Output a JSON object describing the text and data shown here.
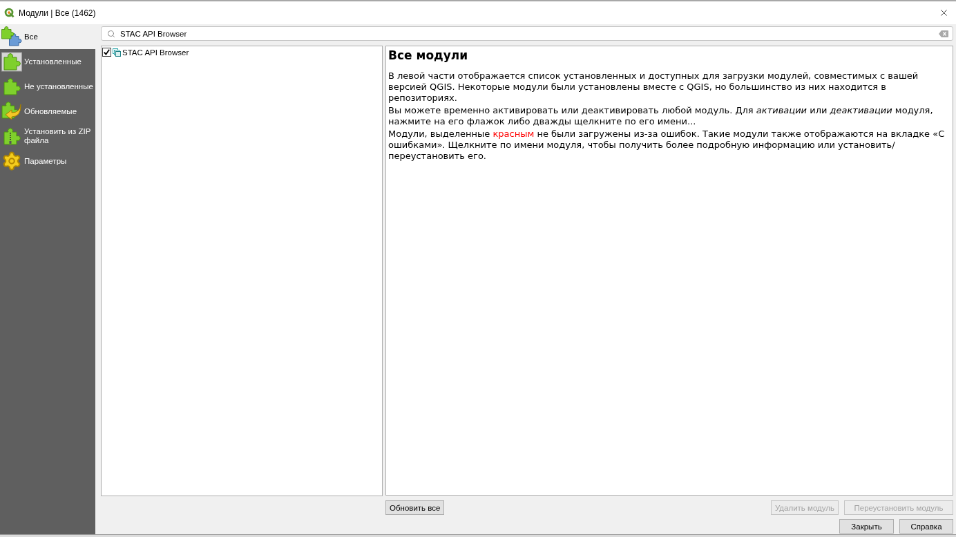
{
  "window": {
    "title": "Модули | Все (1462)"
  },
  "sidebar": {
    "items": [
      {
        "label": "Все",
        "kind": "all",
        "selected": true
      },
      {
        "label": "Установленные",
        "kind": "installed",
        "selected": false
      },
      {
        "label": "Не установленные",
        "kind": "not_installed",
        "selected": false
      },
      {
        "label": "Обновляемые",
        "kind": "upgradeable",
        "selected": false
      },
      {
        "label": "Установить из ZIP файла",
        "kind": "zip",
        "selected": false
      },
      {
        "label": "Параметры",
        "kind": "settings",
        "selected": false
      }
    ]
  },
  "search": {
    "value": "STAC API Browser"
  },
  "plugin_list": {
    "items": [
      {
        "name": "STAC API Browser",
        "checked": true
      }
    ]
  },
  "info": {
    "title": "Все модули",
    "paragraphs": [
      {
        "segments": [
          {
            "text": "В левой части отображается список установленных и доступных для загрузки модулей, совместимых с вашей версией QGIS. Некоторые модули были установлены вместе с QGIS, но большинство из них находится в репозиториях.",
            "kind": "plain"
          }
        ]
      },
      {
        "segments": [
          {
            "text": "Вы можете временно активировать или деактивировать любой модуль. Для *активации* или *деактивации* модуля, нажмите на его флажок либо дважды щелкните по его имени...",
            "kind": "plain"
          }
        ]
      },
      {
        "segments": [
          {
            "text": "Модули, выделенные ",
            "kind": "plain"
          },
          {
            "text": "красным",
            "kind": "error"
          },
          {
            "text": " не были загружены из-за ошибок. Такие модули также отображаются на вкладке «С ошибками». Щелкните по имени модуля, чтобы получить более подробную информацию или установить/переустановить его.",
            "kind": "plain"
          }
        ]
      }
    ]
  },
  "upgrade_all_button": {
    "label": "Обновить все",
    "disabled": false
  },
  "uninstall_button": {
    "label": "Удалить модуль",
    "disabled": true
  },
  "reinstall_button": {
    "label": "Переустановить модуль",
    "disabled": true
  },
  "close_button": {
    "label": "Закрыть",
    "disabled": false
  },
  "help_button": {
    "label": "Справка",
    "disabled": false
  }
}
